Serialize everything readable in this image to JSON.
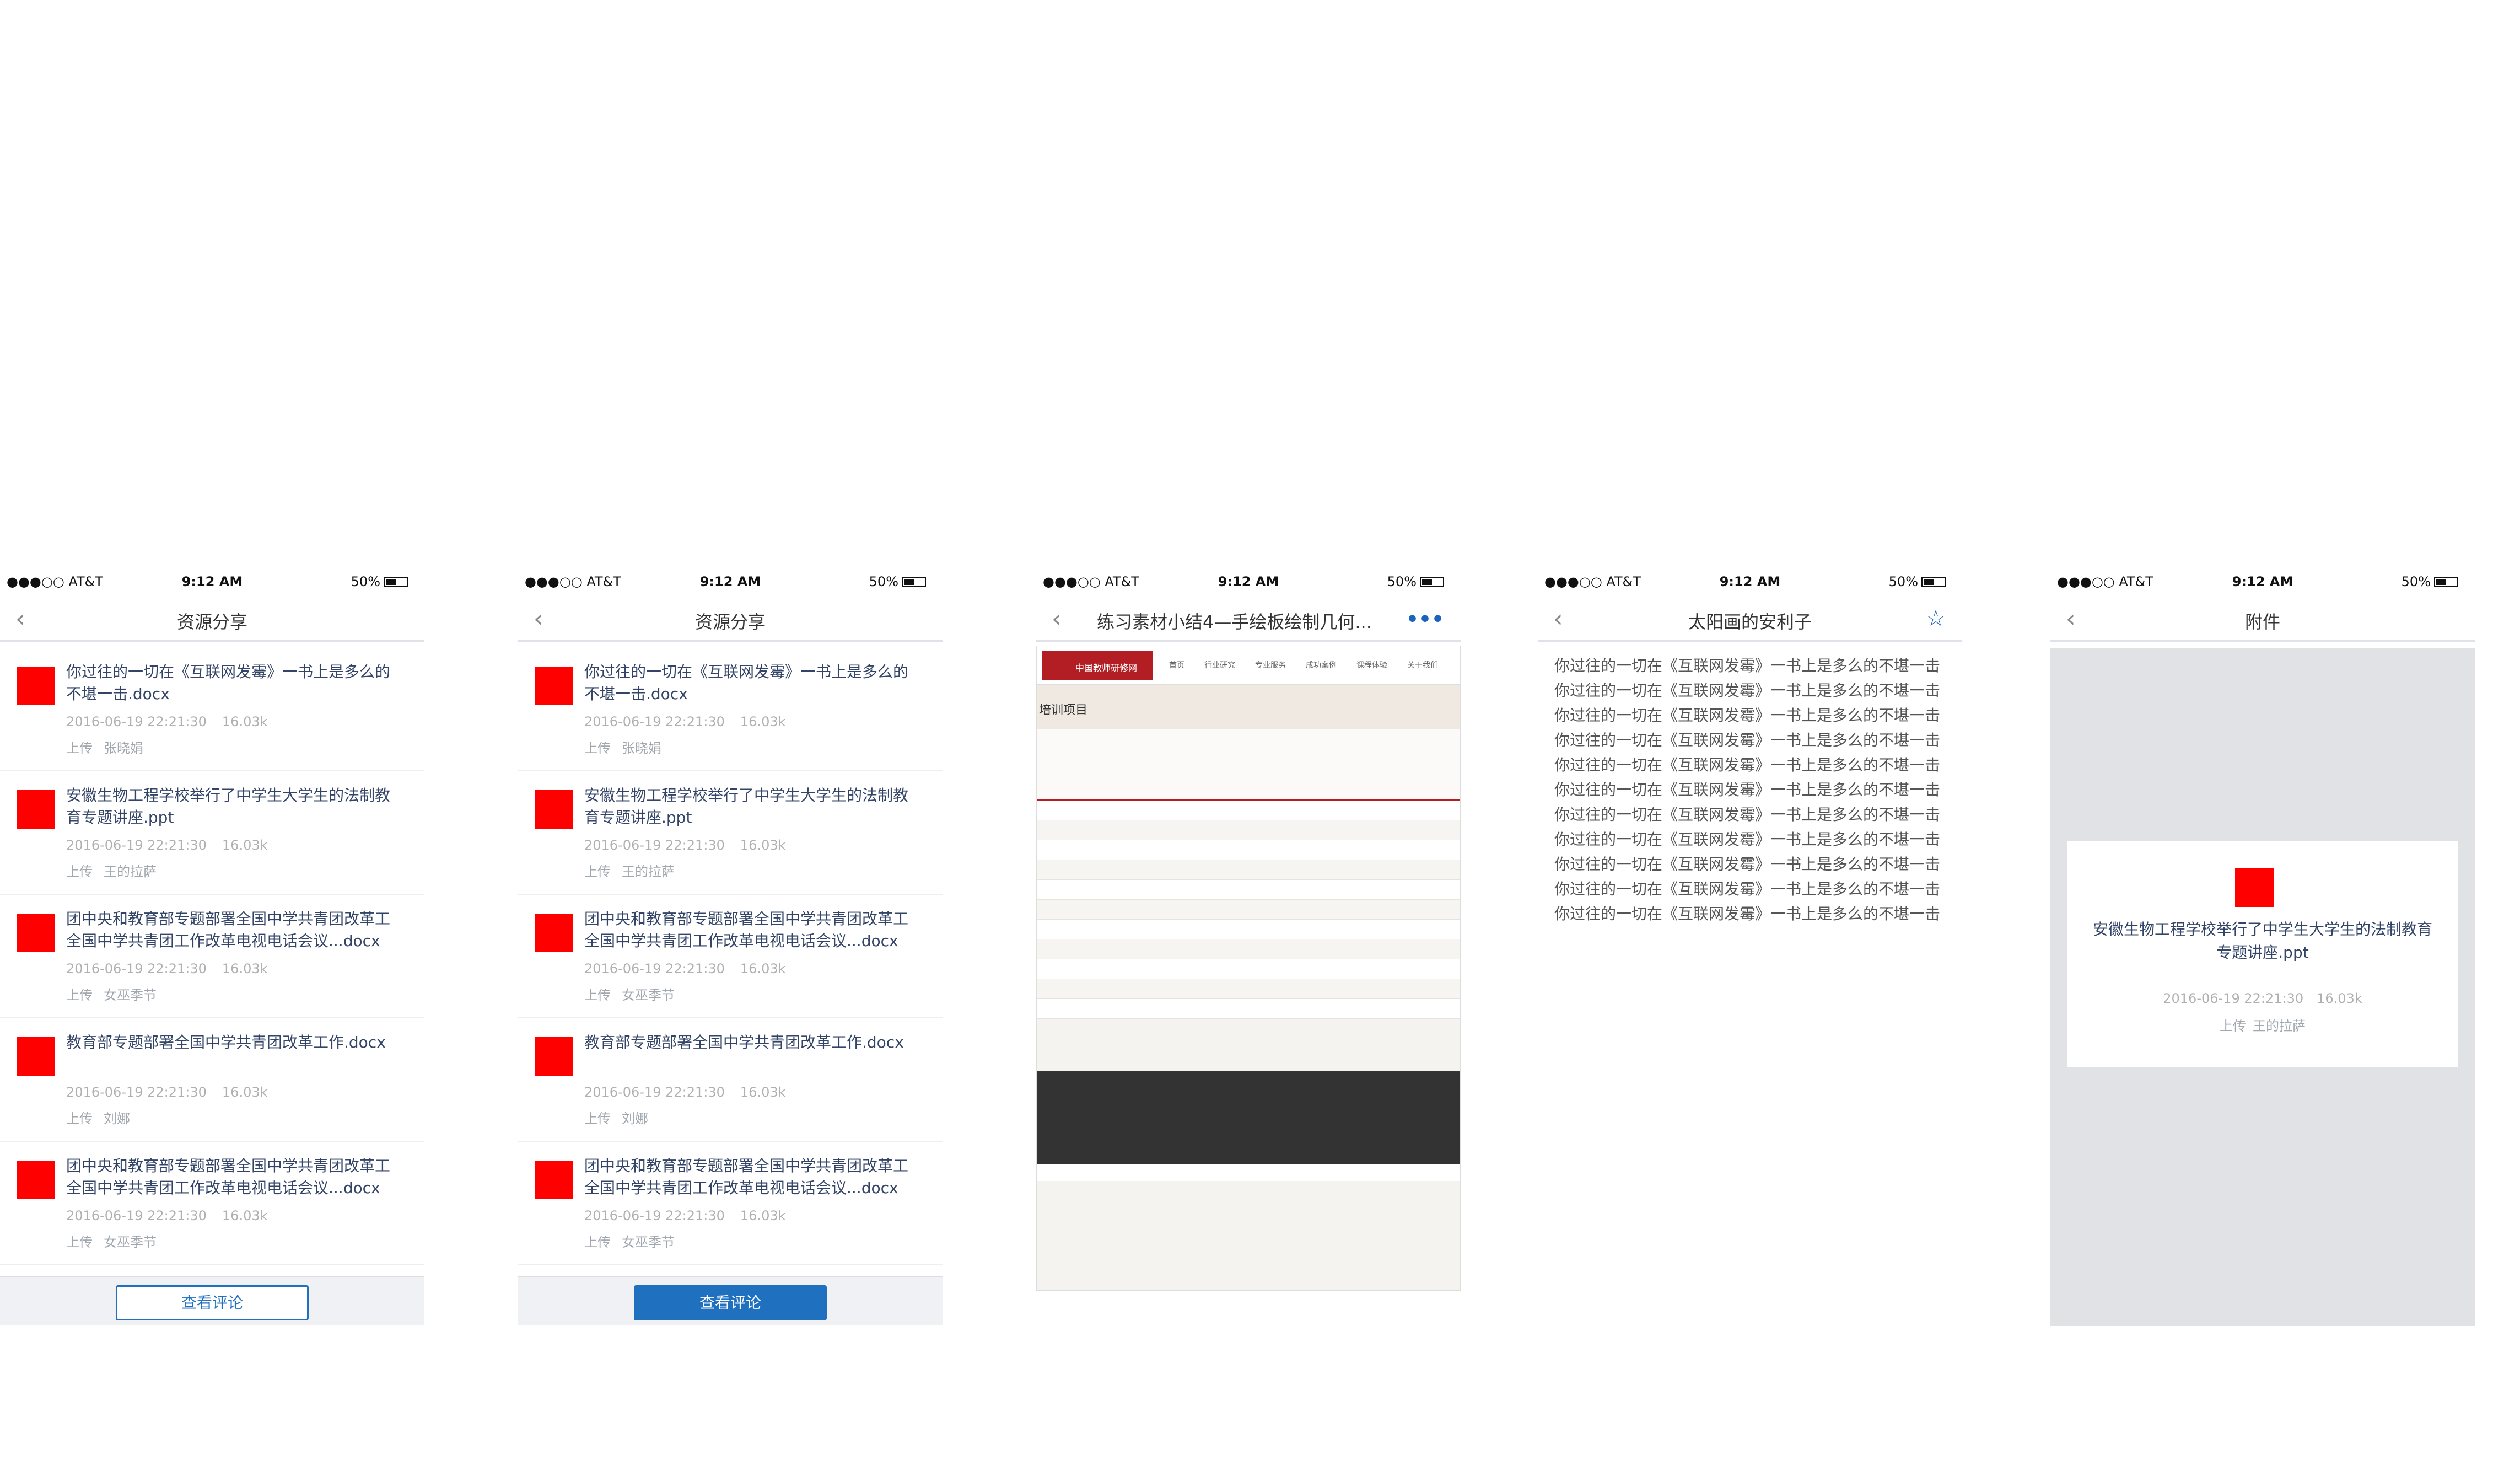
{
  "status": {
    "carrier": "●●●○○ AT&T",
    "time": "9:12 AM",
    "battery": "50%"
  },
  "phone1": {
    "title": "资源分享",
    "comment_button": "查看评论",
    "items": [
      {
        "title": "你过往的一切在《互联网发霉》一书上是多么的不堪一击.docx",
        "date": "2016-06-19 22:21:30",
        "size": "16.03k",
        "upload_label": "上传",
        "uploader": "张晓娟"
      },
      {
        "title": "安徽生物工程学校举行了中学生大学生的法制教育专题讲座.ppt",
        "date": "2016-06-19 22:21:30",
        "size": "16.03k",
        "upload_label": "上传",
        "uploader": "王的拉萨"
      },
      {
        "title": "团中央和教育部专题部署全国中学共青团改革工全国中学共青团工作改革电视电话会议...docx",
        "date": "2016-06-19 22:21:30",
        "size": "16.03k",
        "upload_label": "上传",
        "uploader": "女巫季节"
      },
      {
        "title": "教育部专题部署全国中学共青团改革工作.docx",
        "date": "2016-06-19 22:21:30",
        "size": "16.03k",
        "upload_label": "上传",
        "uploader": "刘娜"
      },
      {
        "title": "团中央和教育部专题部署全国中学共青团改革工全国中学共青团工作改革电视电话会议...docx",
        "date": "2016-06-19 22:21:30",
        "size": "16.03k",
        "upload_label": "上传",
        "uploader": "女巫季节"
      }
    ]
  },
  "phone3": {
    "title": "练习素材小结4—手绘板绘制几何...",
    "more_icon": "•••",
    "web": {
      "logo": "中国教师研修网",
      "menu": [
        "首页",
        "行业研究",
        "专业服务",
        "成功案例",
        "课程体验",
        "关于我们"
      ],
      "banner_title": "培训项目"
    }
  },
  "phone4": {
    "title": "太阳画的安利子",
    "body": "你过往的一切在《互联网发霉》一书上是多么的不堪一击你过往的一切在《互联网发霉》一书上是多么的不堪一击你过往的一切在《互联网发霉》一书上是多么的不堪一击你过往的一切在《互联网发霉》一书上是多么的不堪一击你过往的一切在《互联网发霉》一书上是多么的不堪一击你过往的一切在《互联网发霉》一书上是多么的不堪一击你过往的一切在《互联网发霉》一书上是多么的不堪一击你过往的一切在《互联网发霉》一书上是多么的不堪一击你过往的一切在《互联网发霉》一书上是多么的不堪一击你过往的一切在《互联网发霉》一书上是多么的不堪一击你过往的一切在《互联网发霉》一书上是多么的不堪一击"
  },
  "phone5": {
    "title": "附件",
    "file_title": "安徽生物工程学校举行了中学生大学生的法制教育专题讲座.ppt",
    "date": "2016-06-19 22:21:30",
    "size": "16.03k",
    "upload_label": "上传",
    "uploader": "王的拉萨"
  },
  "colors": {
    "thumb": "#ff0000",
    "title": "#334466",
    "meta": "#a1a7ae",
    "accent": "#2070c0",
    "divider": "#eeeeee"
  }
}
